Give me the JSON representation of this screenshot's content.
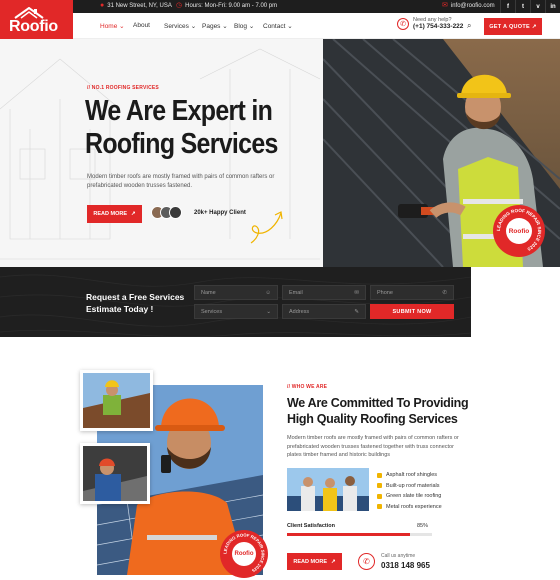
{
  "brand": {
    "logo_text": "Roofio",
    "accent": "#e12828"
  },
  "topbar": {
    "address": "31 New Street, NY, USA",
    "hours": "Hours: Mon-Fri: 9.00 am - 7.00 pm",
    "email": "info@roofio.com",
    "social": [
      "f",
      "t",
      "v",
      "in"
    ]
  },
  "nav": {
    "items": [
      "Home",
      "About",
      "Services",
      "Pages",
      "Blog",
      "Contact"
    ],
    "active": "Home",
    "help_label": "Need any help?",
    "help_phone": "(+1) 754-333-222",
    "quote_button": "GET A QUOTE"
  },
  "hero": {
    "tag": "// NO.1 ROOFING SERVICES",
    "title_line1": "We Are Expert in",
    "title_line2": "Roofing Services",
    "description": "Modern timber roofs are mostly framed with pairs of common rafters or prefabricated wooden trusses fastened.",
    "read_more": "READ MORE",
    "happy_client": "20k+ Happy Client",
    "badge_text": "Roofio",
    "badge_ring": "LEADING ROOF REPAIR SINCE 2025"
  },
  "request": {
    "title": "Request a Free Services Estimate Today !",
    "name_placeholder": "Name",
    "email_placeholder": "Email",
    "phone_placeholder": "Phone",
    "services_placeholder": "Services",
    "address_placeholder": "Address",
    "submit": "SUBMIT NOW"
  },
  "about": {
    "tag": "// WHO WE ARE",
    "title": "We Are Committed To Providing High Quality Roofing Services",
    "description": "Modern timber roofs are mostly framed with pairs of common rafters or prefabricated wooden trusses fastened together with truss connector plates timber framed and historic buildings",
    "features": [
      "Asphalt roof shingles",
      "Built-up roof materials",
      "Green slate tile roofing",
      "Metal roofs experience"
    ],
    "satisfaction_label": "Client Satisfaction",
    "satisfaction_value": "85%",
    "satisfaction_fraction": 0.85,
    "read_more": "READ MORE",
    "call_label": "Call us anytime",
    "call_number": "0318 148 965",
    "badge_text": "Roofio",
    "badge_ring": "LEADING ROOF REPAIR SINCE 2025"
  }
}
